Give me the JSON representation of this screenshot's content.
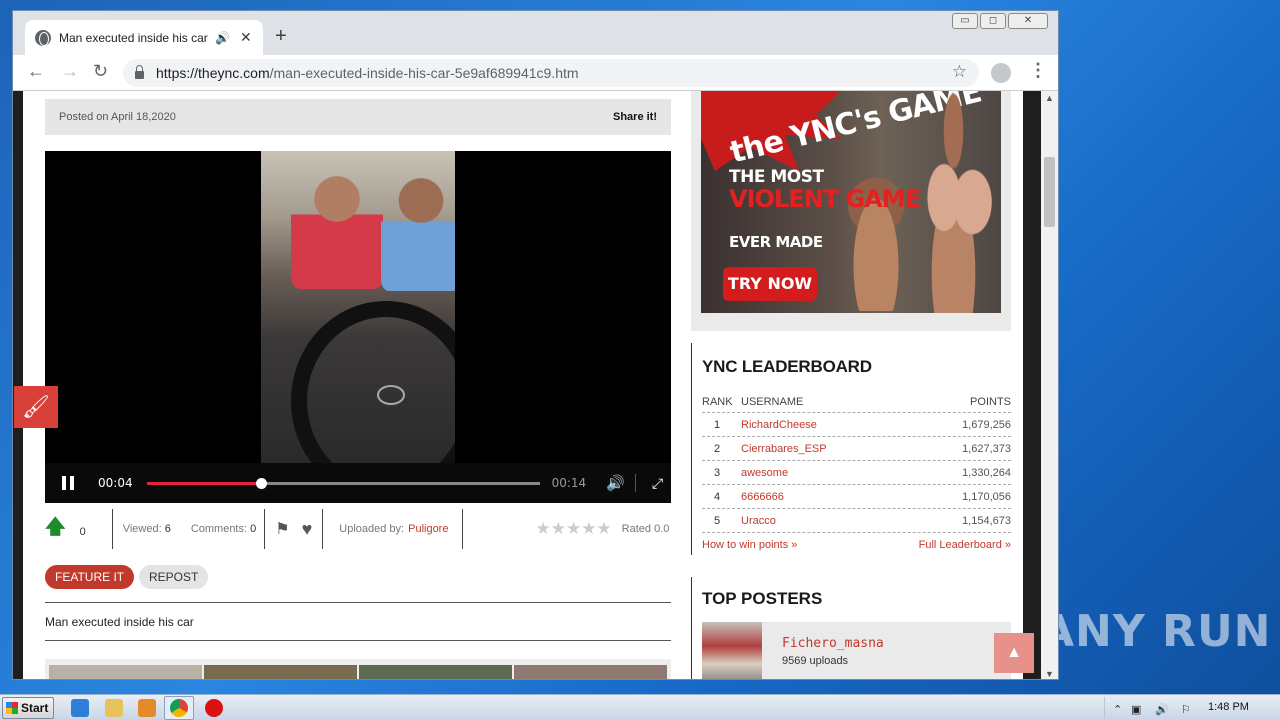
{
  "desktop": {
    "watermark": "ANY RUN"
  },
  "browser": {
    "tab_title": "Man executed inside his car | th",
    "url_host": "https://theync.com",
    "url_path": "/man-executed-inside-his-car-5e9af689941c9.htm",
    "window_buttons": {
      "minimize": "▭",
      "maximize": "◻",
      "close": "✕"
    }
  },
  "post": {
    "posted_on": "Posted on April 18,2020",
    "share": "Share it!",
    "video": {
      "current_time": "00:04",
      "duration": "00:14",
      "progress_fraction": 0.29
    },
    "votes": "0",
    "viewed_label": "Viewed:",
    "viewed": "6",
    "comments_label": "Comments:",
    "comments": "0",
    "uploaded_by_label": "Uploaded by:",
    "uploader": "Puligore",
    "rated": "Rated 0.0",
    "feature_btn": "FEATURE IT",
    "repost_btn": "REPOST",
    "description": "Man executed inside his car"
  },
  "ad": {
    "headline": "the YNC's GAME",
    "line1": "THE MOST",
    "line2": "VIOLENT GAME",
    "line3": "EVER MADE",
    "cta": "TRY NOW"
  },
  "leaderboard": {
    "title": "YNC LEADERBOARD",
    "headers": {
      "rank": "RANK",
      "username": "USERNAME",
      "points": "POINTS"
    },
    "rows": [
      {
        "rank": "1",
        "user": "RichardCheese",
        "points": "1,679,256"
      },
      {
        "rank": "2",
        "user": "Cierrabares_ESP",
        "points": "1,627,373"
      },
      {
        "rank": "3",
        "user": "awesome",
        "points": "1,330,264"
      },
      {
        "rank": "4",
        "user": "6666666",
        "points": "1,170,056"
      },
      {
        "rank": "5",
        "user": "Uracco",
        "points": "1,154,673"
      }
    ],
    "how_to_win": "How to win points »",
    "full": "Full Leaderboard »"
  },
  "top_posters": {
    "title": "TOP POSTERS",
    "poster_name": "Fichero_masna",
    "poster_uploads": "9569 uploads"
  },
  "taskbar": {
    "start": "Start",
    "clock": "1:48 PM"
  },
  "colors": {
    "accent": "#c0392b",
    "upvote": "#1e8c2e",
    "progress": "#e0243a"
  }
}
